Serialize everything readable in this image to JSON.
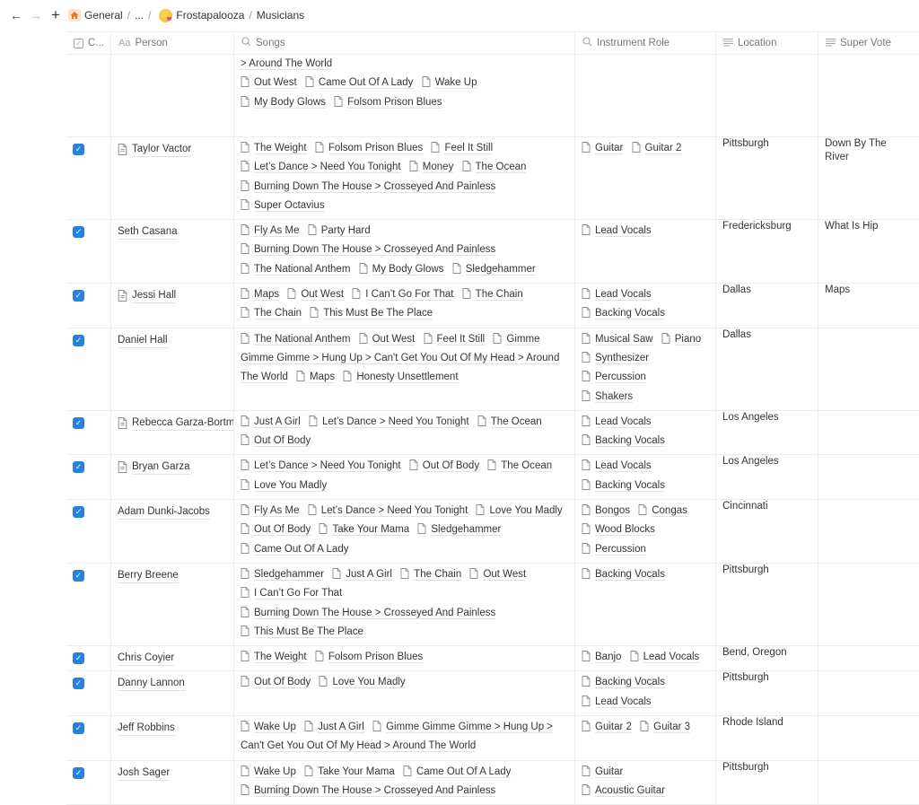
{
  "topbar": {
    "back_icon": "arrow-left-icon",
    "forward_icon": "arrow-right-icon",
    "add_icon": "plus-icon",
    "breadcrumb": [
      "General",
      "...",
      "Frostapalooza",
      "Musicians"
    ]
  },
  "columns": [
    {
      "label": "C...",
      "icon": "checkbox-icon"
    },
    {
      "label": "Person",
      "icon": "text-aa-icon"
    },
    {
      "label": "Songs",
      "icon": "search-icon"
    },
    {
      "label": "Instrument Role",
      "icon": "search-icon"
    },
    {
      "label": "Location",
      "icon": "text-lines-icon"
    },
    {
      "label": "Super Vote",
      "icon": "text-lines-icon"
    }
  ],
  "partial_row": {
    "songs_continuation": "> Around The World",
    "songs": [
      "Out West",
      "Came Out Of A Lady",
      "Wake Up",
      "My Body Glows",
      "Folsom Prison Blues"
    ]
  },
  "rows": [
    {
      "checked": true,
      "person": "Taylor Vactor",
      "has_page_icon": true,
      "songs": [
        "The Weight",
        "Folsom Prison Blues",
        "Feel It Still",
        "Let’s Dance > Need You Tonight",
        "Money",
        "The Ocean",
        "Burning Down The House > Crosseyed And Painless",
        "Super Octavius"
      ],
      "roles": [
        "Guitar",
        "Guitar 2"
      ],
      "location": "Pittsburgh",
      "super_vote": "Down By The River"
    },
    {
      "checked": true,
      "person": "Seth Casana",
      "has_page_icon": false,
      "songs": [
        "Fly As Me",
        "Party Hard",
        "Burning Down The House > Crosseyed And Painless",
        "The National Anthem",
        "My Body Glows",
        "Sledgehammer"
      ],
      "roles": [
        "Lead Vocals"
      ],
      "location": "Fredericksburg",
      "super_vote": "What Is Hip"
    },
    {
      "checked": true,
      "person": "Jessi Hall",
      "has_page_icon": true,
      "songs": [
        "Maps",
        "Out West",
        "I Can’t Go For That",
        "The Chain",
        "The Chain",
        "This Must Be The Place"
      ],
      "roles": [
        "Lead Vocals",
        "Backing Vocals"
      ],
      "location": "Dallas",
      "super_vote": "Maps"
    },
    {
      "checked": true,
      "person": "Daniel Hall",
      "has_page_icon": false,
      "songs": [
        "The National Anthem",
        "Out West",
        "Feel It Still",
        "Gimme Gimme Gimme > Hung Up > Can't Get You Out Of My Head > Around The World",
        "Maps",
        "Honesty Unsettlement"
      ],
      "roles": [
        "Musical Saw",
        "Piano",
        "Synthesizer",
        "Percussion",
        "Shakers"
      ],
      "location": "Dallas",
      "super_vote": ""
    },
    {
      "checked": true,
      "person": "Rebecca Garza-Bortman",
      "has_page_icon": true,
      "songs": [
        "Just A Girl",
        "Let’s Dance > Need You Tonight",
        "The Ocean",
        "Out Of Body"
      ],
      "roles": [
        "Lead Vocals",
        "Backing Vocals"
      ],
      "location": "Los Angeles",
      "super_vote": ""
    },
    {
      "checked": true,
      "person": "Bryan Garza",
      "has_page_icon": true,
      "songs": [
        "Let’s Dance > Need You Tonight",
        "Out Of Body",
        "The Ocean",
        "Love You Madly"
      ],
      "roles": [
        "Lead Vocals",
        "Backing Vocals"
      ],
      "location": "Los Angeles",
      "super_vote": ""
    },
    {
      "checked": true,
      "person": "Adam Dunki-Jacobs",
      "has_page_icon": false,
      "songs": [
        "Fly As Me",
        "Let’s Dance > Need You Tonight",
        "Love You Madly",
        "Out Of Body",
        "Take Your Mama",
        "Sledgehammer",
        "Came Out Of A Lady"
      ],
      "roles": [
        "Bongos",
        "Congas",
        "Wood Blocks",
        "Percussion"
      ],
      "location": "Cincinnati",
      "super_vote": ""
    },
    {
      "checked": true,
      "person": "Berry Breene",
      "has_page_icon": false,
      "songs": [
        "Sledgehammer",
        "Just A Girl",
        "The Chain",
        "Out West",
        "I Can’t Go For That",
        "Burning Down The House > Crosseyed And Painless",
        "This Must Be The Place"
      ],
      "roles": [
        "Backing Vocals"
      ],
      "location": "Pittsburgh",
      "super_vote": ""
    },
    {
      "checked": true,
      "person": "Chris Coyier",
      "has_page_icon": false,
      "songs": [
        "The Weight",
        "Folsom Prison Blues"
      ],
      "roles": [
        "Banjo",
        "Lead Vocals"
      ],
      "location": "Bend, Oregon",
      "super_vote": ""
    },
    {
      "checked": true,
      "person": "Danny Lannon",
      "has_page_icon": false,
      "songs": [
        "Out Of Body",
        "Love You Madly"
      ],
      "roles": [
        "Backing Vocals",
        "Lead Vocals"
      ],
      "location": "Pittsburgh",
      "super_vote": ""
    },
    {
      "checked": true,
      "person": "Jeff Robbins",
      "has_page_icon": false,
      "songs": [
        "Wake Up",
        "Just A Girl",
        "Gimme Gimme Gimme > Hung Up > Can't Get You Out Of My Head > Around The World"
      ],
      "roles": [
        "Guitar 2",
        "Guitar 3"
      ],
      "location": "Rhode Island",
      "super_vote": ""
    },
    {
      "checked": true,
      "person": "Josh Sager",
      "has_page_icon": false,
      "songs": [
        "Wake Up",
        "Take Your Mama",
        "Came Out Of A Lady",
        "Burning Down The House > Crosseyed And Painless"
      ],
      "roles": [
        "Guitar",
        "Acoustic Guitar"
      ],
      "location": "Pittsburgh",
      "super_vote": ""
    }
  ],
  "colors": {
    "accent": "#2383e2",
    "border": "#ededec",
    "text": "#37352f",
    "muted": "#787774"
  }
}
